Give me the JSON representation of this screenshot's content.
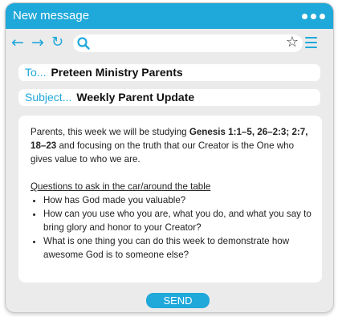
{
  "window": {
    "title": "New message"
  },
  "titlebar": {
    "icon": "more-dots-icon"
  },
  "navbar": {
    "back_icon": "←",
    "forward_icon": "→",
    "refresh_icon": "↻",
    "url_value": ""
  },
  "fields": {
    "to_label": "To...",
    "to_value": "Preteen Ministry Parents",
    "subject_label": "Subject...",
    "subject_value": "Weekly Parent Update"
  },
  "message": {
    "intro_a": "Parents, this week we will be studying ",
    "intro_ref": "Genesis 1:1–5, 26–2:3; 2:7, 18–23",
    "intro_b": " and focusing on the truth that our Creator is the One who gives value to who we are.",
    "questions_heading": "Questions to ask in the car/around the table",
    "questions": [
      "How has God made you valuable?",
      "How can you use who you are, what you do, and what you say to bring glory and honor to your Creator?",
      "What is one thing you can do this week to demonstrate how awesome God is to someone else?"
    ]
  },
  "actions": {
    "send_label": "SEND"
  },
  "colors": {
    "accent": "#1fa8da",
    "window_bg": "#ebebeb"
  }
}
